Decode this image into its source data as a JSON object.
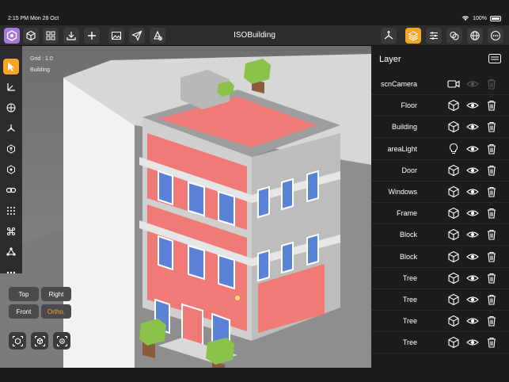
{
  "status": {
    "time": "2:15 PM",
    "date": "Mon 28 Oct",
    "battery": "100%"
  },
  "app": {
    "title": "ISOBuilding"
  },
  "viewport": {
    "grid_label": "Grid : 1.0",
    "selected_label": "Building"
  },
  "view_buttons": {
    "top": "Top",
    "right": "Right",
    "front": "Front",
    "ortho": "Ortho."
  },
  "panel": {
    "title": "Layer",
    "layers": [
      {
        "name": "scnCamera",
        "type": "camera-icon",
        "visible": false
      },
      {
        "name": "Floor",
        "type": "cube-icon",
        "visible": true
      },
      {
        "name": "Building",
        "type": "cube-icon",
        "visible": true
      },
      {
        "name": "areaLight",
        "type": "lightbulb-icon",
        "visible": true
      },
      {
        "name": "Door",
        "type": "cube-icon",
        "visible": true
      },
      {
        "name": "Windows",
        "type": "cube-icon",
        "visible": true
      },
      {
        "name": "Frame",
        "type": "cube-icon",
        "visible": true
      },
      {
        "name": "Block",
        "type": "cube-icon",
        "visible": true
      },
      {
        "name": "Block",
        "type": "cube-icon",
        "visible": true
      },
      {
        "name": "Tree",
        "type": "cube-icon",
        "visible": true
      },
      {
        "name": "Tree",
        "type": "cube-icon",
        "visible": true
      },
      {
        "name": "Tree",
        "type": "cube-icon",
        "visible": true
      },
      {
        "name": "Tree",
        "type": "cube-icon",
        "visible": true
      }
    ]
  },
  "colors": {
    "accent_orange": "#f5a623",
    "accent_purple": "#a77ad9",
    "building_red": "#f07a75",
    "wall_gray": "#c7c7c7"
  }
}
